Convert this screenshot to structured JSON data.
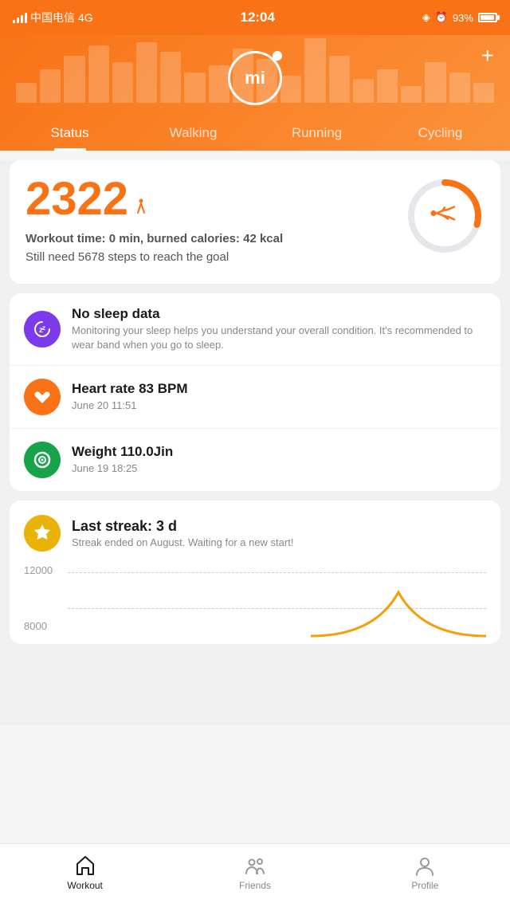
{
  "statusBar": {
    "carrier": "中国电信",
    "network": "4G",
    "time": "12:04",
    "battery": "93%",
    "batteryFull": 93
  },
  "header": {
    "logo": "mi",
    "plus": "+",
    "tabs": [
      {
        "id": "status",
        "label": "Status",
        "active": true
      },
      {
        "id": "walking",
        "label": "Walking",
        "active": false
      },
      {
        "id": "running",
        "label": "Running",
        "active": false
      },
      {
        "id": "cycling",
        "label": "Cycling",
        "active": false
      }
    ]
  },
  "stepsCard": {
    "steps": "2322",
    "unit": "👟",
    "workoutInfo": "Workout time: 0 min, burned calories: 42 kcal",
    "goalInfo": "Still need 5678 steps to reach the goal",
    "progressPercent": 29,
    "goalSteps": 8000,
    "currentSteps": 2322
  },
  "healthCards": [
    {
      "id": "sleep",
      "iconType": "sleep",
      "iconSymbol": "😴",
      "title": "No sleep data",
      "subtitle": "Monitoring your sleep helps you understand your overall condition. It's recommended to wear band when you go to sleep."
    },
    {
      "id": "heart",
      "iconType": "heart",
      "iconSymbol": "❤️",
      "title": "Heart rate 83 BPM",
      "subtitle": "June 20 11:51"
    },
    {
      "id": "weight",
      "iconType": "weight",
      "iconSymbol": "⚖️",
      "title": "Weight 110.0Jin",
      "subtitle": "June 19 18:25"
    }
  ],
  "streakCard": {
    "iconSymbol": "🛡️",
    "title": "Last streak: 3 d",
    "subtitle": "Streak ended on August. Waiting for a new start!",
    "chartLabels": [
      "12000",
      "8000"
    ],
    "chartDashed": true
  },
  "bottomNav": [
    {
      "id": "workout",
      "label": "Workout",
      "active": true,
      "icon": "home"
    },
    {
      "id": "friends",
      "label": "Friends",
      "active": false,
      "icon": "friends"
    },
    {
      "id": "profile",
      "label": "Profile",
      "active": false,
      "icon": "profile"
    }
  ]
}
